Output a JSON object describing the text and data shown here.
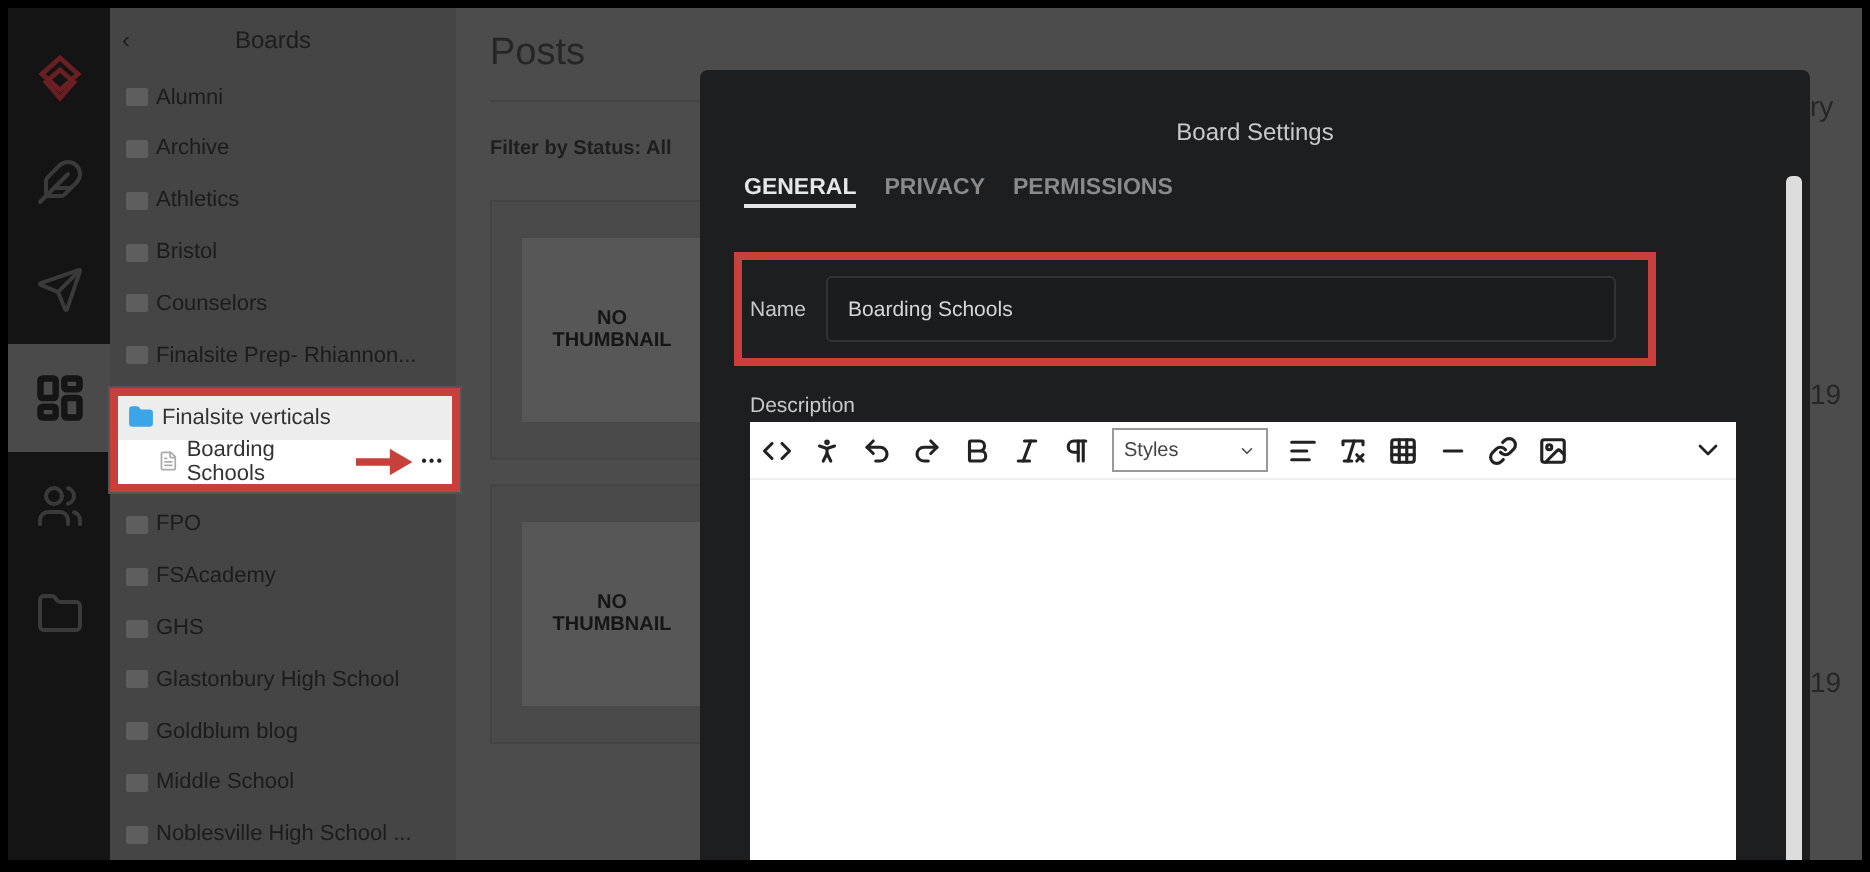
{
  "rail": {
    "items": [
      {
        "kind": "logo",
        "selected": false
      },
      {
        "kind": "feather",
        "selected": false
      },
      {
        "kind": "send",
        "selected": false
      },
      {
        "kind": "dashboard",
        "selected": true
      },
      {
        "kind": "people",
        "selected": false
      },
      {
        "kind": "folder",
        "selected": false
      }
    ]
  },
  "sidebar": {
    "back": "‹",
    "title": "Boards",
    "items": [
      {
        "label": "Alumni"
      },
      {
        "label": "Archive"
      },
      {
        "label": "Athletics"
      },
      {
        "label": "Bristol"
      },
      {
        "label": "Counselors"
      },
      {
        "label": "Finalsite Prep- Rhiannon..."
      },
      {
        "label": "Finalsite verticals",
        "expanded": true,
        "children": [
          {
            "label": "Boarding Schools",
            "more": "•••"
          }
        ]
      },
      {
        "label": "FPO"
      },
      {
        "label": "FSAcademy"
      },
      {
        "label": "GHS"
      },
      {
        "label": "Glastonbury High School"
      },
      {
        "label": "Goldblum blog"
      },
      {
        "label": "Middle School"
      },
      {
        "label": "Noblesville High School ..."
      }
    ]
  },
  "main": {
    "title": "Posts",
    "filter": "Filter by Status: All",
    "cards": [
      {
        "thumbnail": "NO THUMBNAIL"
      },
      {
        "thumbnail": "NO THUMBNAIL"
      }
    ],
    "column_2": [
      "ry",
      "19",
      "19"
    ]
  },
  "modal": {
    "title": "Board Settings",
    "tabs": [
      {
        "label": "GENERAL",
        "selected": true
      },
      {
        "label": "PRIVACY",
        "selected": false
      },
      {
        "label": "PERMISSIONS",
        "selected": false
      }
    ],
    "name": {
      "label": "Name",
      "value": "Boarding Schools"
    },
    "description": {
      "label": "Description",
      "styles": "Styles"
    }
  }
}
